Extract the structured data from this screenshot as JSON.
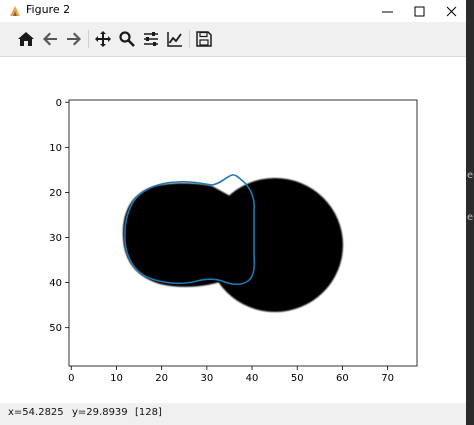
{
  "window": {
    "title": "Figure 2",
    "minimize": "minimize",
    "maximize": "maximize",
    "close": "close"
  },
  "toolbar": {
    "items": [
      {
        "name": "home",
        "icon": "home-icon"
      },
      {
        "name": "back",
        "icon": "arrow-left-icon"
      },
      {
        "name": "forward",
        "icon": "arrow-right-icon"
      },
      {
        "name": "pan",
        "icon": "move-icon"
      },
      {
        "name": "zoom",
        "icon": "magnifier-icon"
      },
      {
        "name": "configure-subplots",
        "icon": "sliders-icon"
      },
      {
        "name": "edit-axes",
        "icon": "line-chart-icon"
      },
      {
        "name": "save",
        "icon": "floppy-disk-icon"
      }
    ]
  },
  "figure": {
    "x_ticks": [
      "0",
      "10",
      "20",
      "30",
      "40",
      "50",
      "60",
      "70"
    ],
    "y_ticks": [
      "0",
      "10",
      "20",
      "30",
      "40",
      "50"
    ],
    "image_shape": {
      "cols": 77,
      "rows": 59
    },
    "blob_color": "#000000",
    "contour_color": "#1f77b4"
  },
  "status": {
    "x": "x=54.2825",
    "y": "y=29.8939",
    "value": "[128]"
  },
  "background_side_chars": [
    "e",
    "e"
  ]
}
